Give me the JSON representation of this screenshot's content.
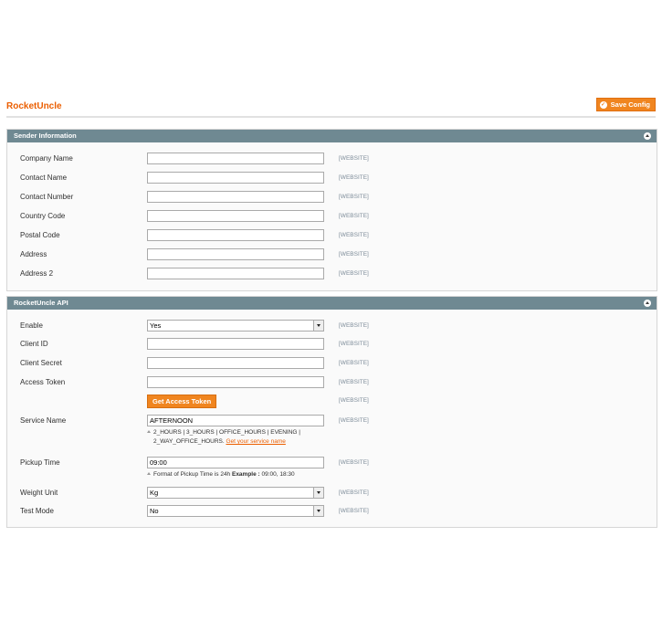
{
  "header": {
    "title": "RocketUncle",
    "save_label": "Save Config"
  },
  "scope_label": "[WEBSITE]",
  "sender": {
    "title": "Sender Information",
    "fields": {
      "company_name": {
        "label": "Company Name",
        "value": ""
      },
      "contact_name": {
        "label": "Contact Name",
        "value": ""
      },
      "contact_number": {
        "label": "Contact Number",
        "value": ""
      },
      "country_code": {
        "label": "Country Code",
        "value": ""
      },
      "postal_code": {
        "label": "Postal Code",
        "value": ""
      },
      "address": {
        "label": "Address",
        "value": ""
      },
      "address2": {
        "label": "Address 2",
        "value": ""
      }
    }
  },
  "api": {
    "title": "RocketUncle API",
    "enable": {
      "label": "Enable",
      "value": "Yes"
    },
    "client_id": {
      "label": "Client ID",
      "value": ""
    },
    "client_secret": {
      "label": "Client Secret",
      "value": ""
    },
    "access_token": {
      "label": "Access Token",
      "value": ""
    },
    "get_token_label": "Get Access Token",
    "service_name": {
      "label": "Service Name",
      "value": "AFTERNOON",
      "note_line1": "2_HOURS | 3_HOURS | OFFICE_HOURS | EVENING |",
      "note_line2": "2_WAY_OFFICE_HOURS.",
      "note_link": "Get your service name"
    },
    "pickup_time": {
      "label": "Pickup Time",
      "value": "09:00",
      "note_prefix": "Format of Pickup Time is 24h",
      "note_bold": "Example :",
      "note_suffix": "09:00, 18:30"
    },
    "weight_unit": {
      "label": "Weight Unit",
      "value": "Kg"
    },
    "test_mode": {
      "label": "Test Mode",
      "value": "No"
    }
  }
}
